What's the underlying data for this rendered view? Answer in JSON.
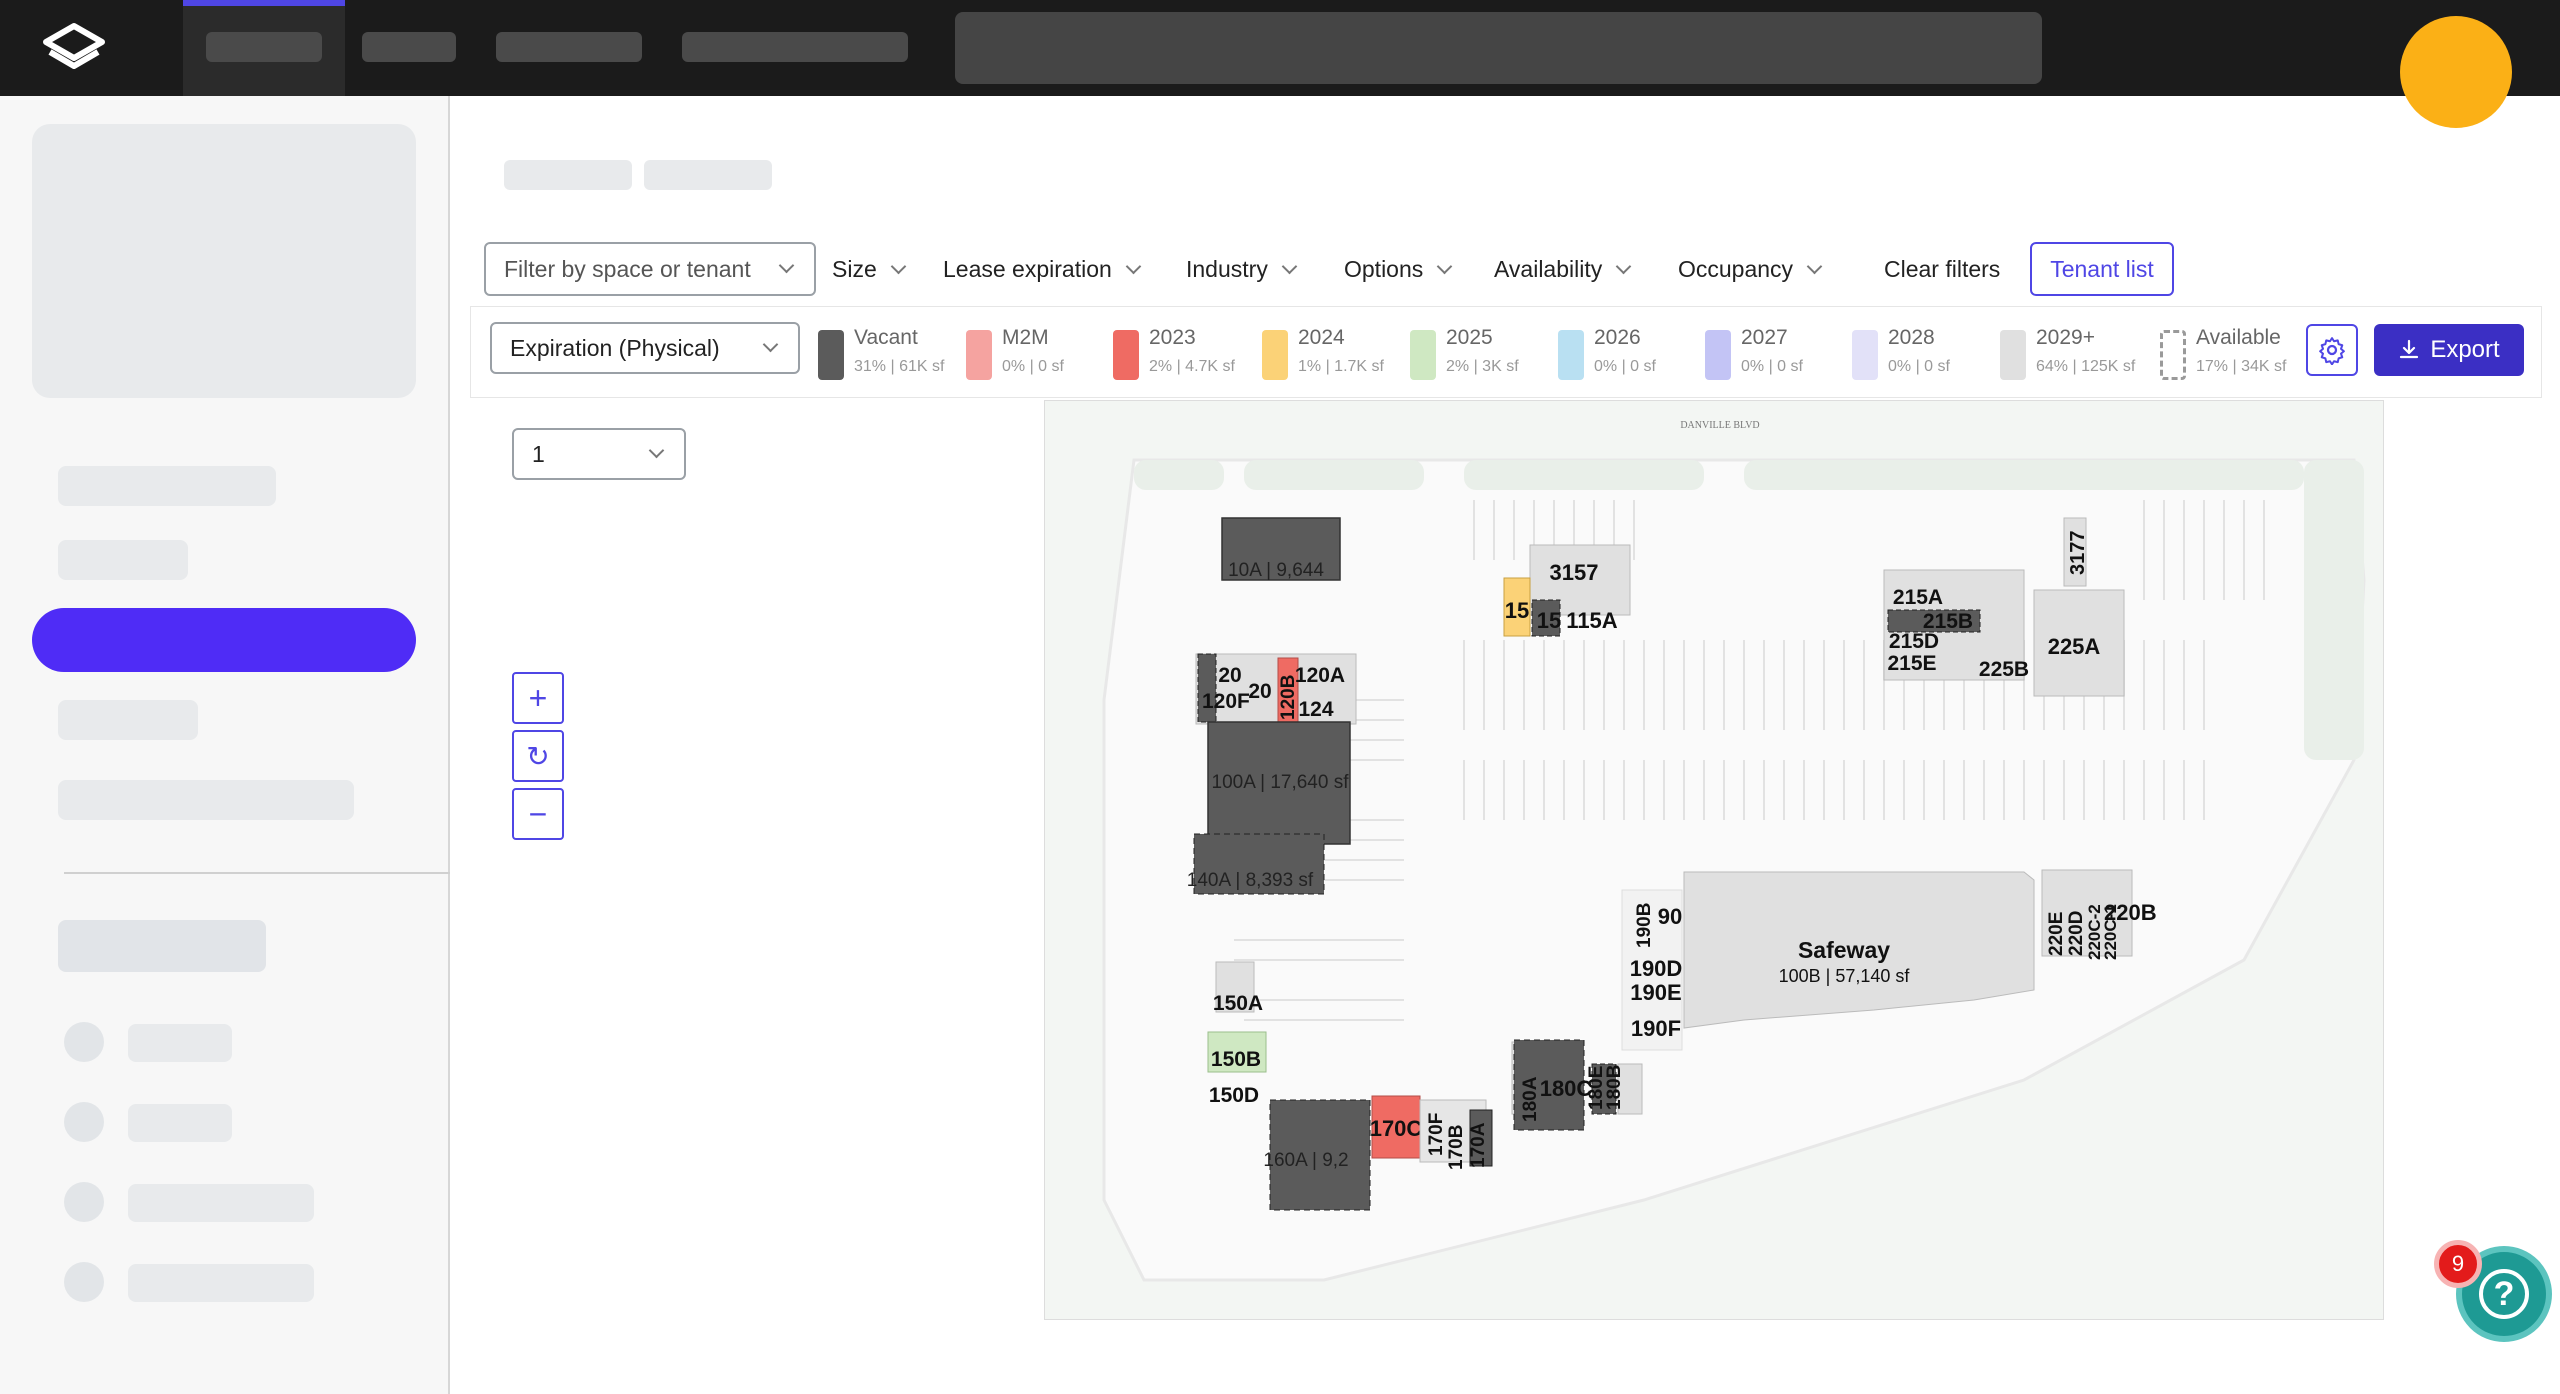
{
  "filters": {
    "search_placeholder": "Filter by space or tenant",
    "items": [
      {
        "label": "Size"
      },
      {
        "label": "Lease expiration"
      },
      {
        "label": "Industry"
      },
      {
        "label": "Options"
      },
      {
        "label": "Availability"
      },
      {
        "label": "Occupancy"
      }
    ],
    "clear_label": "Clear filters",
    "tenant_list_label": "Tenant list"
  },
  "legend": {
    "mode_select": "Expiration (Physical)",
    "items": [
      {
        "label": "Vacant",
        "stat": "31% | 61K sf",
        "color": "#5b5b5b"
      },
      {
        "label": "M2M",
        "stat": "0% | 0 sf",
        "color": "#f5a3a0"
      },
      {
        "label": "2023",
        "stat": "2% | 4.7K sf",
        "color": "#ef6b63"
      },
      {
        "label": "2024",
        "stat": "1% | 1.7K sf",
        "color": "#fbd277"
      },
      {
        "label": "2025",
        "stat": "2% | 3K sf",
        "color": "#cfe8c2"
      },
      {
        "label": "2026",
        "stat": "0% | 0 sf",
        "color": "#b9e0f2"
      },
      {
        "label": "2027",
        "stat": "0% | 0 sf",
        "color": "#c3c4f5"
      },
      {
        "label": "2028",
        "stat": "0% | 0 sf",
        "color": "#e2e1f8"
      },
      {
        "label": "2029+",
        "stat": "64% | 125K sf",
        "color": "#e0e0e0"
      },
      {
        "label": "Available",
        "stat": "17% | 34K sf",
        "color": "dashed"
      }
    ],
    "export_label": "Export"
  },
  "floor": {
    "selected": "1"
  },
  "zoom": {
    "in": "+",
    "reset": "↻",
    "out": "−"
  },
  "map": {
    "street_label": "DANVILLE BLVD",
    "anchor_name": "Safeway",
    "anchor_detail": "100B | 57,140 sf",
    "unit_labels": [
      "10A | 9,644",
      "3157",
      "15",
      "15",
      "115A",
      "3177",
      "215A",
      "215B",
      "215D",
      "215E",
      "225A",
      "225B",
      "20",
      "20",
      "120B",
      "120A",
      "120F",
      "124",
      "100A | 17,640 sf",
      "140A | 8,393 sf",
      "190B",
      "90",
      "190D",
      "190E",
      "190F",
      "220E",
      "220D",
      "220C-2",
      "220C-1",
      "220B",
      "150A",
      "150B",
      "150D",
      "160A | 9,2",
      "170C",
      "170F",
      "170B",
      "170A",
      "180A",
      "180C",
      "180E",
      "180B"
    ]
  },
  "help": {
    "badge_count": "9",
    "icon": "question-mark-icon"
  }
}
